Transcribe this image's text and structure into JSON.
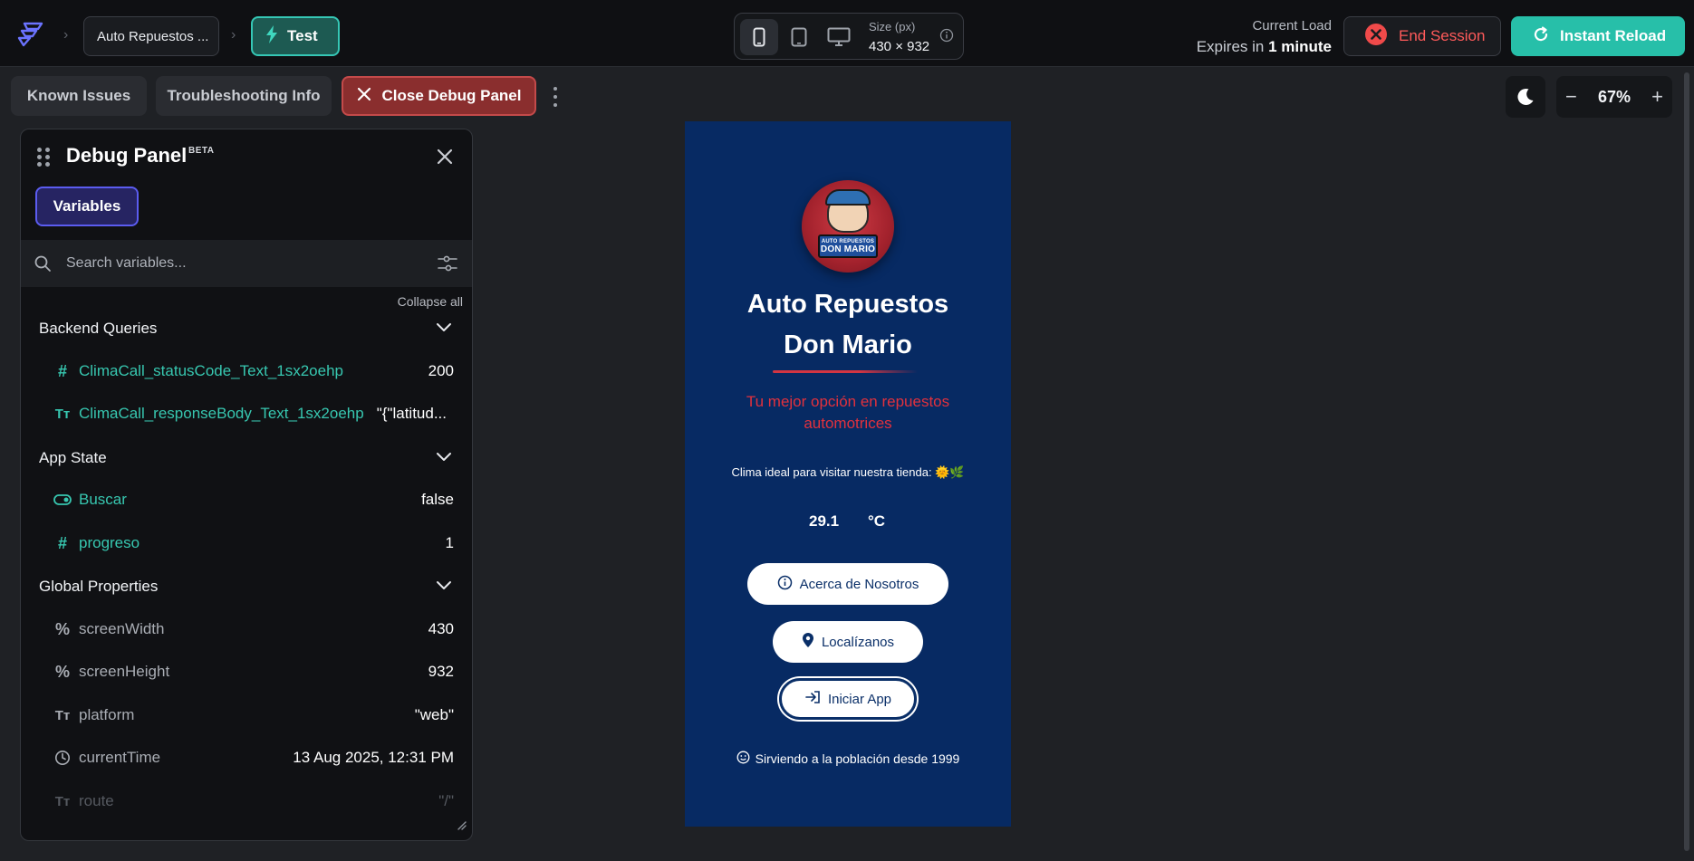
{
  "topbar": {
    "project_chip": "Auto Repuestos ...",
    "test_chip": "Test",
    "size_label": "Size (px)",
    "size_value": "430 × 932",
    "current_load_label": "Current Load",
    "expires_prefix": "Expires in",
    "expires_value": "1 minute",
    "end_session": "End Session",
    "instant_reload": "Instant Reload",
    "active_device": "mobile"
  },
  "toolbar": {
    "known_issues": "Known Issues",
    "troubleshooting": "Troubleshooting Info",
    "close_debug": "Close Debug Panel",
    "zoom": "67%"
  },
  "debug": {
    "title": "Debug Panel",
    "beta": "BETA",
    "tab_variables": "Variables",
    "search_placeholder": "Search variables...",
    "collapse_all": "Collapse all",
    "sections": [
      {
        "label": "Backend Queries",
        "rows": [
          {
            "icon": "number-icon",
            "name": "ClimaCall_statusCode_Text_1sx2oehp",
            "value": "200"
          },
          {
            "icon": "text-icon",
            "name": "ClimaCall_responseBody_Text_1sx2oehp",
            "value": "\"{\"latitud..."
          }
        ]
      },
      {
        "label": "App State",
        "rows": [
          {
            "icon": "toggle-icon",
            "name": "Buscar",
            "value": "false"
          },
          {
            "icon": "number-icon",
            "name": "progreso",
            "value": "1"
          }
        ]
      },
      {
        "label": "Global Properties",
        "rows": [
          {
            "icon": "percent-icon",
            "name": "screenWidth",
            "value": "430"
          },
          {
            "icon": "percent-icon",
            "name": "screenHeight",
            "value": "932"
          },
          {
            "icon": "text-icon",
            "name": "platform",
            "value": "\"web\""
          },
          {
            "icon": "clock-icon",
            "name": "currentTime",
            "value": "13 Aug 2025, 12:31 PM"
          },
          {
            "icon": "text-icon",
            "name": "route",
            "value": "\"/\""
          }
        ]
      }
    ]
  },
  "preview": {
    "logo_text_line1": "AUTO REPUESTOS",
    "logo_text_line2": "DON MARIO",
    "title_line1": "Auto Repuestos",
    "title_line2": "Don Mario",
    "tagline": "Tu mejor opción en repuestos automotrices",
    "weather_text": "Clima ideal para visitar nuestra tienda: 🌞🌿",
    "temperature": "29.1",
    "temperature_unit": "°C",
    "btn_about": "Acerca de Nosotros",
    "btn_locate": "Localízanos",
    "btn_start": "Iniciar App",
    "footer": "Sirviendo a la población desde 1999"
  },
  "colors": {
    "accent_teal": "#27bfa9",
    "danger_red": "#ff5a5a",
    "preview_bg": "#072a63",
    "brand_red": "#e2313d",
    "variables_tab": "#5b5cf0"
  }
}
